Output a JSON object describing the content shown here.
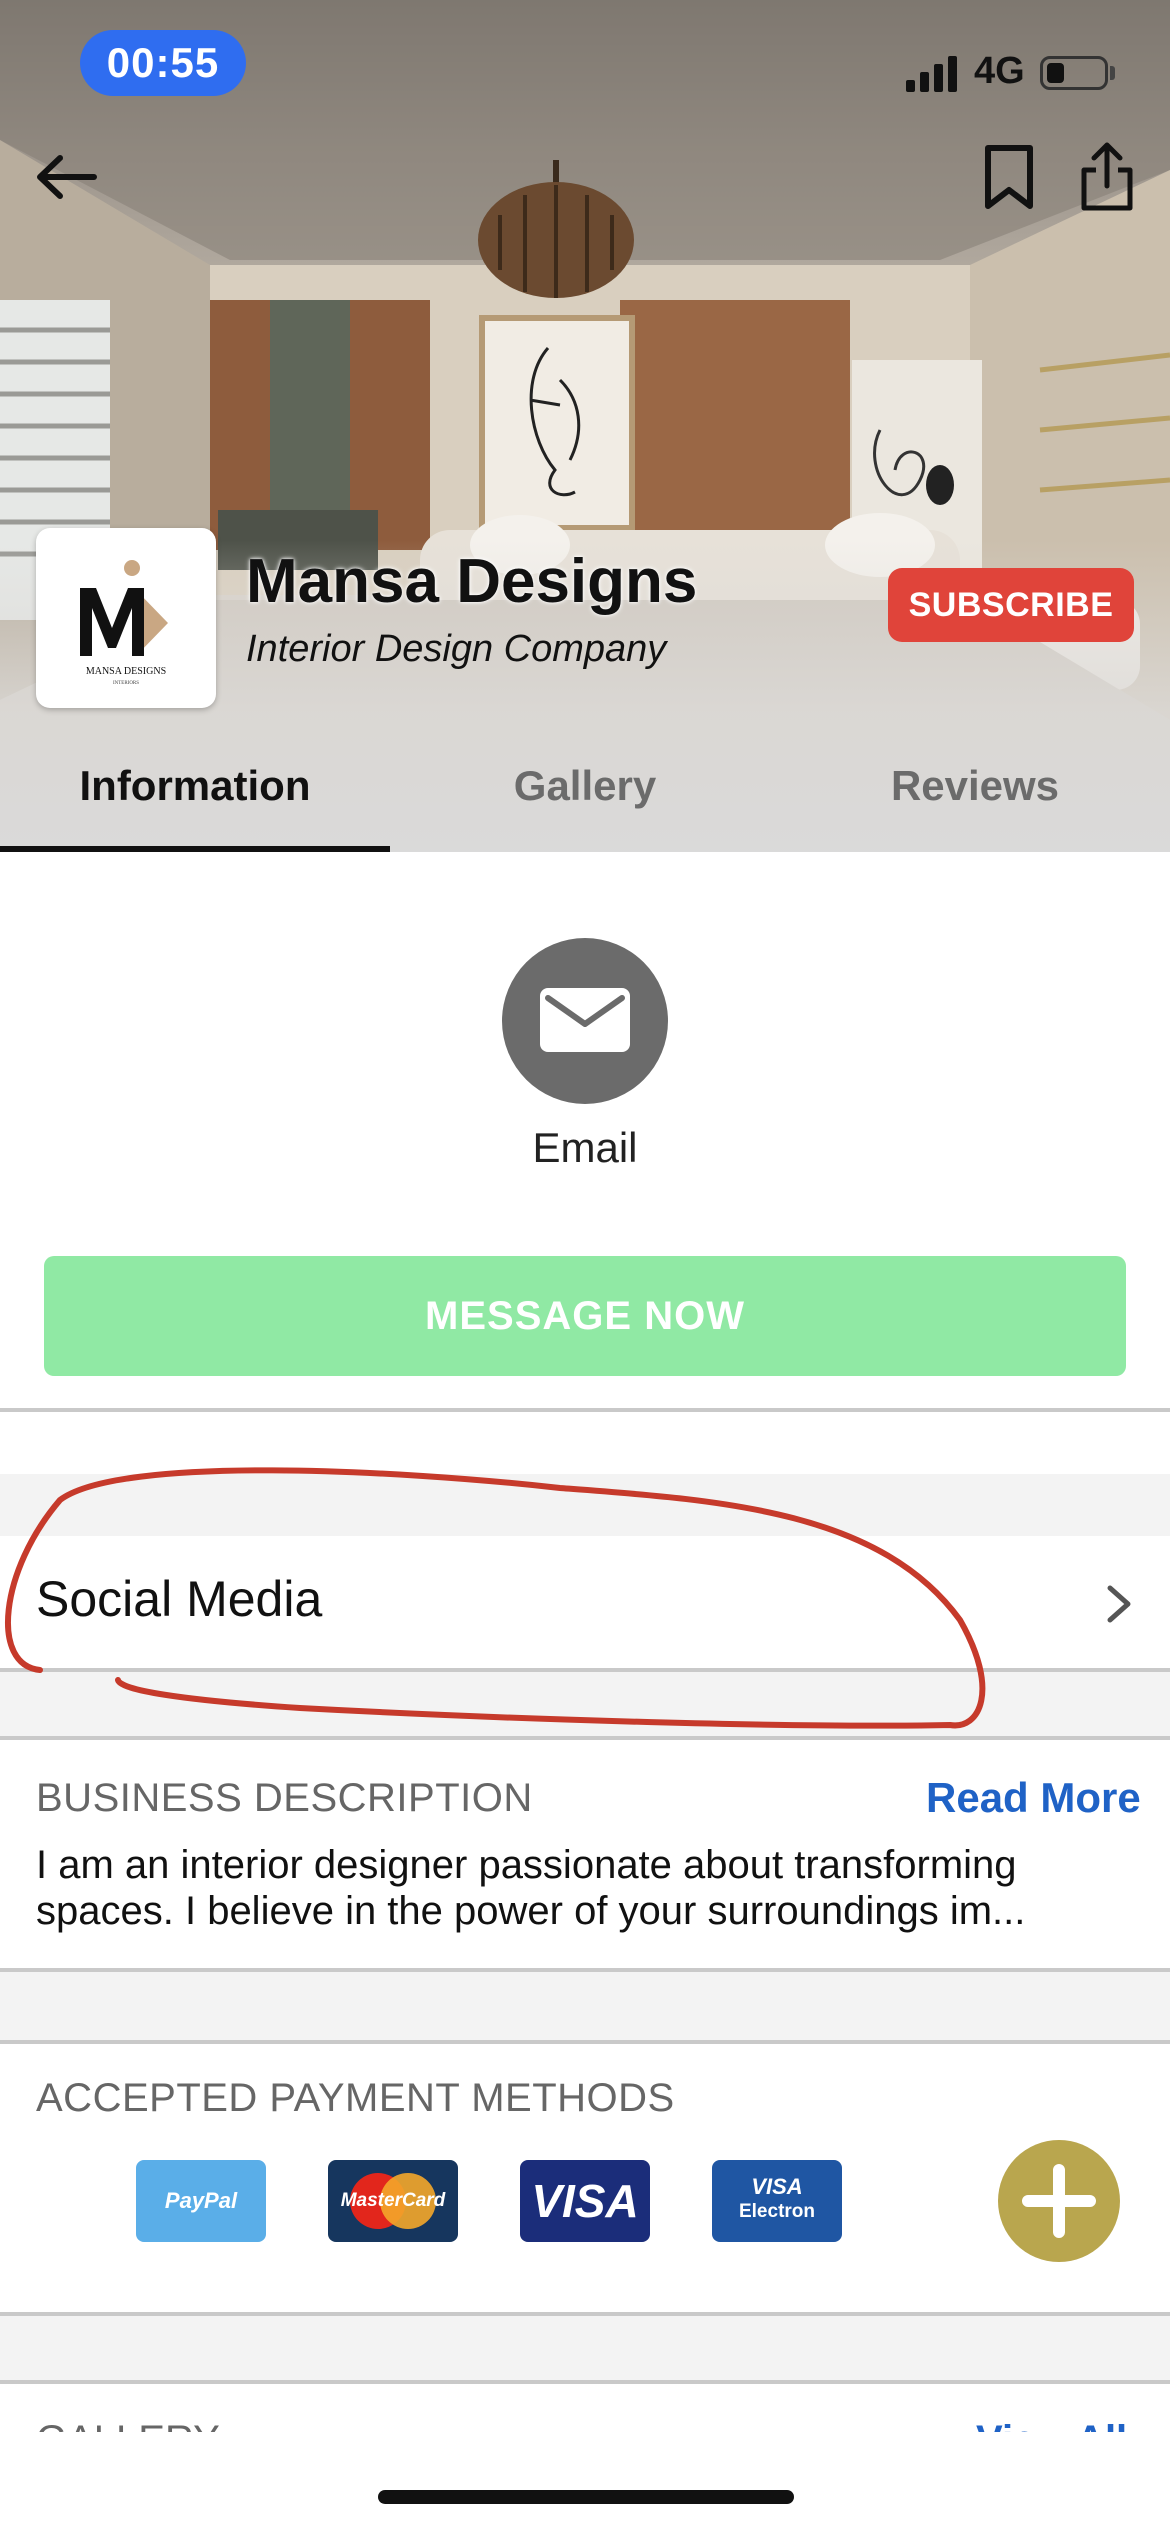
{
  "status_bar": {
    "time": "00:55",
    "network": "4G",
    "battery_level": 0.3
  },
  "header": {
    "back_icon": "arrow-left-icon",
    "bookmark_icon": "bookmark-icon",
    "share_icon": "share-icon"
  },
  "profile": {
    "name": "Mansa Designs",
    "subtitle": "Interior Design Company",
    "logo_text": "MANSA DESIGNS",
    "logo_subtext": "INTERIORS",
    "subscribe_label": "SUBSCRIBE"
  },
  "tabs": [
    {
      "label": "Information",
      "active": true
    },
    {
      "label": "Gallery",
      "active": false
    },
    {
      "label": "Reviews",
      "active": false
    }
  ],
  "contact": {
    "email_icon": "envelope-icon",
    "email_label": "Email",
    "message_button": "MESSAGE NOW"
  },
  "social": {
    "label": "Social Media",
    "chevron_icon": "chevron-right-icon"
  },
  "business_description": {
    "title": "BUSINESS DESCRIPTION",
    "read_more": "Read More",
    "text": "I am an interior designer passionate about transforming spaces. I believe in the power of your surroundings im..."
  },
  "payment": {
    "title": "ACCEPTED PAYMENT METHODS",
    "methods": [
      {
        "name": "PayPal",
        "color": "#5aaee8"
      },
      {
        "name": "MasterCard",
        "color": "#16365e"
      },
      {
        "name": "VISA",
        "color": "#1b2d7a"
      },
      {
        "name": "VISA",
        "sub": "Electron",
        "color": "#1f56a3"
      }
    ],
    "add_icon": "plus-icon"
  },
  "gallery_section": {
    "title": "GALLERY",
    "view_all": "View All"
  },
  "colors": {
    "accent_blue": "#1f62c6",
    "subscribe_red": "#e0443a",
    "message_green": "#90e9a4",
    "add_gold": "#b9a64e",
    "annotation_red": "#c63a2b"
  }
}
